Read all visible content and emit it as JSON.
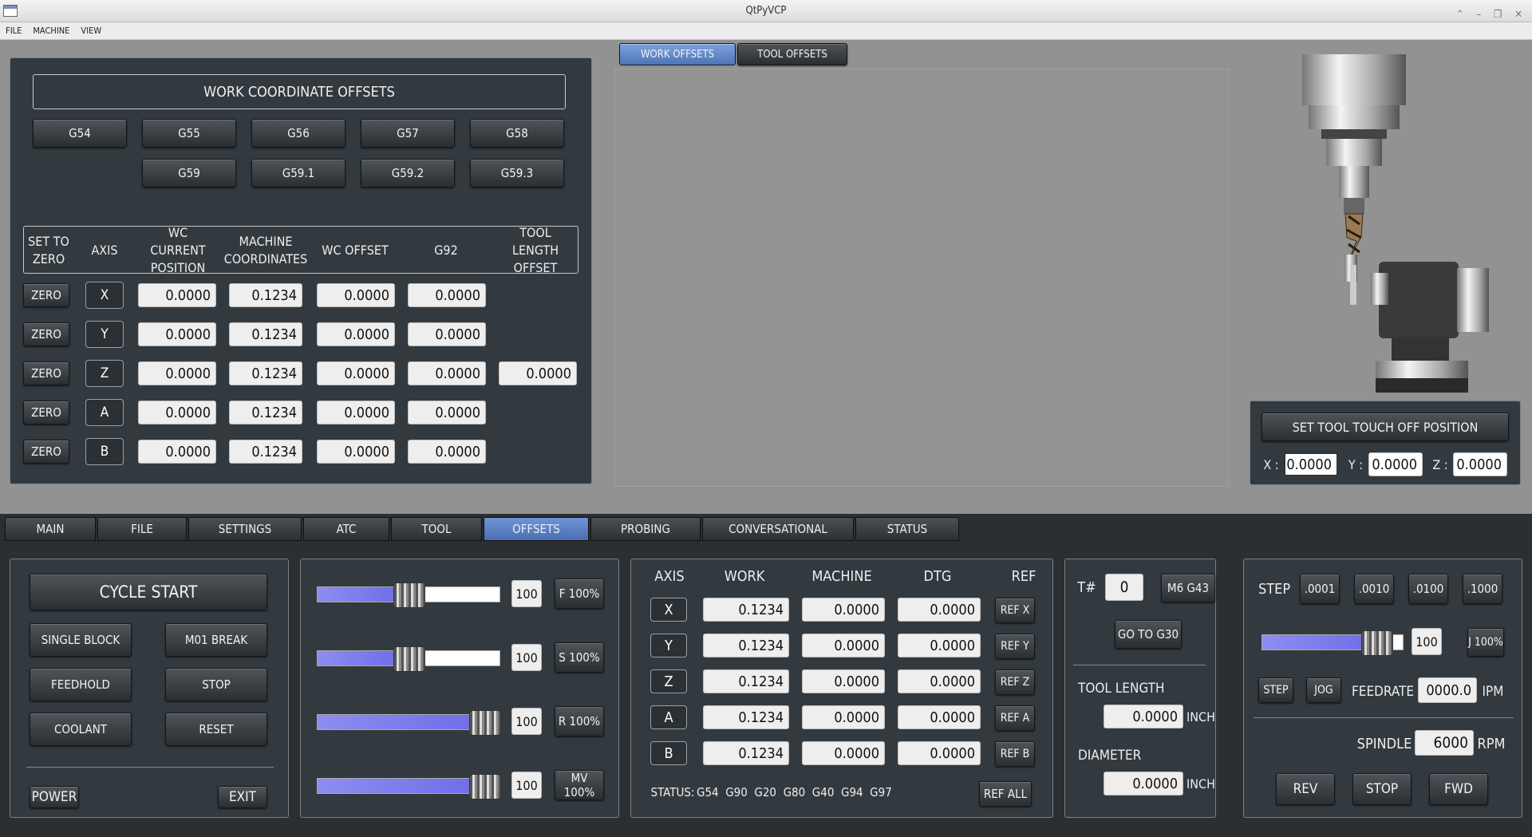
{
  "window": {
    "title": "QtPyVCP"
  },
  "menu": [
    "FILE",
    "MACHINE",
    "VIEW"
  ],
  "offsets_panel": {
    "title": "WORK COORDINATE OFFSETS",
    "coord_buttons_row1": [
      "G54",
      "G55",
      "G56",
      "G57",
      "G58"
    ],
    "coord_buttons_row2": [
      "G59",
      "G59.1",
      "G59.2",
      "G59.3"
    ],
    "headers": [
      "SET TO ZERO",
      "AXIS",
      "WC CURRENT POSITION",
      "MACHINE COORDINATES",
      "WC OFFSET",
      "G92",
      "TOOL LENGTH OFFSET"
    ],
    "rows": [
      {
        "zero": "ZERO",
        "axis": "X",
        "wc": "0.0000",
        "mach": "0.1234",
        "off": "0.0000",
        "g92": "0.0000",
        "tlo": ""
      },
      {
        "zero": "ZERO",
        "axis": "Y",
        "wc": "0.0000",
        "mach": "0.1234",
        "off": "0.0000",
        "g92": "0.0000",
        "tlo": ""
      },
      {
        "zero": "ZERO",
        "axis": "Z",
        "wc": "0.0000",
        "mach": "0.1234",
        "off": "0.0000",
        "g92": "0.0000",
        "tlo": "0.0000"
      },
      {
        "zero": "ZERO",
        "axis": "A",
        "wc": "0.0000",
        "mach": "0.1234",
        "off": "0.0000",
        "g92": "0.0000",
        "tlo": ""
      },
      {
        "zero": "ZERO",
        "axis": "B",
        "wc": "0.0000",
        "mach": "0.1234",
        "off": "0.0000",
        "g92": "0.0000",
        "tlo": ""
      }
    ]
  },
  "offset_tabs": [
    "WORK OFFSETS",
    "TOOL OFFSETS"
  ],
  "touchoff": {
    "button": "SET TOOL TOUCH OFF POSITION",
    "x_label": "X :",
    "y_label": "Y :",
    "z_label": "Z :",
    "x": "0.0000",
    "y": "0.0000",
    "z": "0.0000"
  },
  "main_tabs": [
    "MAIN",
    "FILE",
    "SETTINGS",
    "ATC",
    "TOOL",
    "OFFSETS",
    "PROBING",
    "CONVERSATIONAL",
    "STATUS"
  ],
  "controls": {
    "cycle_start": "CYCLE START",
    "single_block": "SINGLE BLOCK",
    "m01": "M01 BREAK",
    "feedhold": "FEEDHOLD",
    "stop": "STOP",
    "coolant": "COOLANT",
    "reset": "RESET",
    "power": "POWER",
    "exit": "EXIT"
  },
  "overrides": [
    {
      "value": "100",
      "button": "F 100%",
      "fraction": 0.5
    },
    {
      "value": "100",
      "button": "S 100%",
      "fraction": 0.5
    },
    {
      "value": "100",
      "button": "R 100%",
      "fraction": 1.0
    },
    {
      "value": "100",
      "button": "MV 100%",
      "fraction": 1.0
    }
  ],
  "dro": {
    "headers": [
      "AXIS",
      "WORK",
      "MACHINE",
      "DTG",
      "REF"
    ],
    "rows": [
      {
        "axis": "X",
        "work": "0.1234",
        "mach": "0.0000",
        "dtg": "0.0000",
        "ref": "REF X"
      },
      {
        "axis": "Y",
        "work": "0.1234",
        "mach": "0.0000",
        "dtg": "0.0000",
        "ref": "REF Y"
      },
      {
        "axis": "Z",
        "work": "0.1234",
        "mach": "0.0000",
        "dtg": "0.0000",
        "ref": "REF Z"
      },
      {
        "axis": "A",
        "work": "0.1234",
        "mach": "0.0000",
        "dtg": "0.0000",
        "ref": "REF A"
      },
      {
        "axis": "B",
        "work": "0.1234",
        "mach": "0.0000",
        "dtg": "0.0000",
        "ref": "REF B"
      }
    ],
    "status_label": "STATUS:",
    "status_codes": "G54  G90  G20  G80  G40  G94  G97",
    "ref_all": "REF ALL"
  },
  "tool": {
    "t_label": "T#",
    "t_value": "0",
    "m6": "M6 G43",
    "g30": "GO TO G30",
    "length_label": "TOOL LENGTH",
    "length": "0.0000",
    "length_unit": "INCH",
    "dia_label": "DIAMETER",
    "dia": "0.0000",
    "dia_unit": "INCH"
  },
  "jog": {
    "step_label": "STEP",
    "steps": [
      ".0001",
      ".0010",
      ".0100",
      ".1000"
    ],
    "jog_value": "100",
    "jog_btn": "J 100%",
    "jog_fraction": 0.9,
    "step_btn": "STEP",
    "jog_btn2": "JOG",
    "feed_label": "FEEDRATE",
    "feed": "0000.0",
    "feed_unit": "IPM",
    "spindle_label": "SPINDLE",
    "spindle": "6000",
    "spindle_unit": "RPM",
    "rev": "REV",
    "stop": "STOP",
    "fwd": "FWD"
  }
}
